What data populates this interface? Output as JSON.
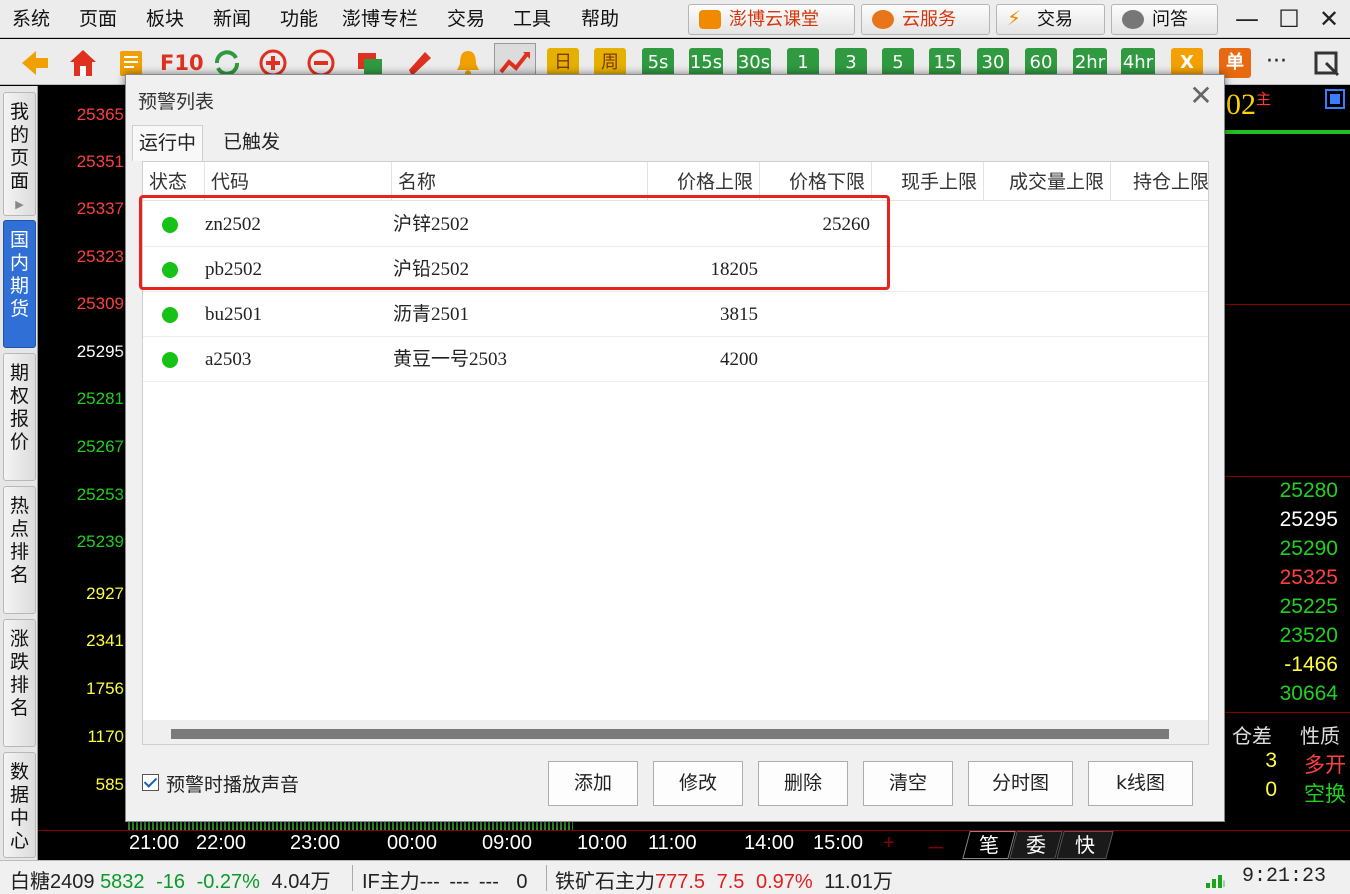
{
  "menu": [
    "系统",
    "页面",
    "板块",
    "新闻",
    "功能",
    "澎博专栏",
    "交易",
    "工具",
    "帮助"
  ],
  "top_buttons": [
    "澎博云课堂",
    "云服务",
    "交易",
    "问答"
  ],
  "window": {
    "minimize": "—",
    "maximize": "☐",
    "close": "✕"
  },
  "toolbar": {
    "f10": "F10",
    "day": "日",
    "week": "周",
    "periods": [
      "5s",
      "15s",
      "30s",
      "1",
      "3",
      "5",
      "15",
      "30",
      "60",
      "2hr",
      "4hr"
    ],
    "x": "X",
    "dan": "单",
    "more": "···"
  },
  "sidenav": {
    "tabs": [
      "我的页面",
      "国内期货",
      "期权报价",
      "热点排名",
      "涨跌排名",
      "数据中心"
    ],
    "arrow": "▶"
  },
  "left_axis": {
    "red": [
      "25365",
      "25351",
      "25337",
      "25323",
      "25309"
    ],
    "white": [
      "25295"
    ],
    "green": [
      "25281",
      "25267",
      "25253",
      "25239"
    ],
    "volume": [
      "2927",
      "2341",
      "1756",
      "1170",
      "585"
    ]
  },
  "right_panel": {
    "title": "02",
    "title_sup": "主",
    "values": [
      {
        "v": "25280",
        "c": "#20d020"
      },
      {
        "v": "25295",
        "c": "#ffffff"
      },
      {
        "v": "25290",
        "c": "#20d020"
      },
      {
        "v": "25325",
        "c": "#ff4040"
      },
      {
        "v": "25225",
        "c": "#20d020"
      },
      {
        "v": "23520",
        "c": "#20d020"
      },
      {
        "v": "-1466",
        "c": "#ffff40"
      },
      {
        "v": "30664",
        "c": "#20d020"
      }
    ],
    "col1": "仓差",
    "col2": "性质",
    "rows": [
      {
        "a": "3",
        "b": "多开"
      },
      {
        "a": "0",
        "b": "空换"
      }
    ]
  },
  "time_axis": [
    "21:00",
    "22:00",
    "23:00",
    "00:00",
    "09:00",
    "10:00",
    "11:00",
    "14:00",
    "15:00"
  ],
  "axis_buttons": {
    "plus": "+",
    "minus": "－"
  },
  "bottom_tabs": [
    "笔",
    "委",
    "快"
  ],
  "status": {
    "s1_name": "白糖2409",
    "s1_price": "5832",
    "s1_chg": "-16",
    "s1_pct": "-0.27%",
    "s1_vol": "4.04万",
    "s2_name": "IF主力",
    "s2_price": "---",
    "s2_chg": "---",
    "s2_pct": "---",
    "s2_vol": "0",
    "s3_name": "铁矿石主力",
    "s3_price": "777.5",
    "s3_chg": "7.5",
    "s3_pct": "0.97%",
    "s3_vol": "11.01万",
    "clock": "9:21:23"
  },
  "dialog": {
    "title": "预警列表",
    "close": "✕",
    "tabs": [
      "运行中",
      "已触发"
    ],
    "columns": [
      "状态",
      "代码",
      "名称",
      "价格上限",
      "价格下限",
      "现手上限",
      "成交量上限",
      "持仓上限"
    ],
    "rows": [
      {
        "code": "zn2502",
        "name": "沪锌2502",
        "upper": "",
        "lower": "25260"
      },
      {
        "code": "pb2502",
        "name": "沪铅2502",
        "upper": "18205",
        "lower": ""
      },
      {
        "code": "bu2501",
        "name": "沥青2501",
        "upper": "3815",
        "lower": ""
      },
      {
        "code": "a2503",
        "name": "黄豆一号2503",
        "upper": "4200",
        "lower": ""
      }
    ],
    "checkbox_label": "预警时播放声音",
    "buttons": [
      "添加",
      "修改",
      "删除",
      "清空",
      "分时图",
      "k线图"
    ]
  }
}
